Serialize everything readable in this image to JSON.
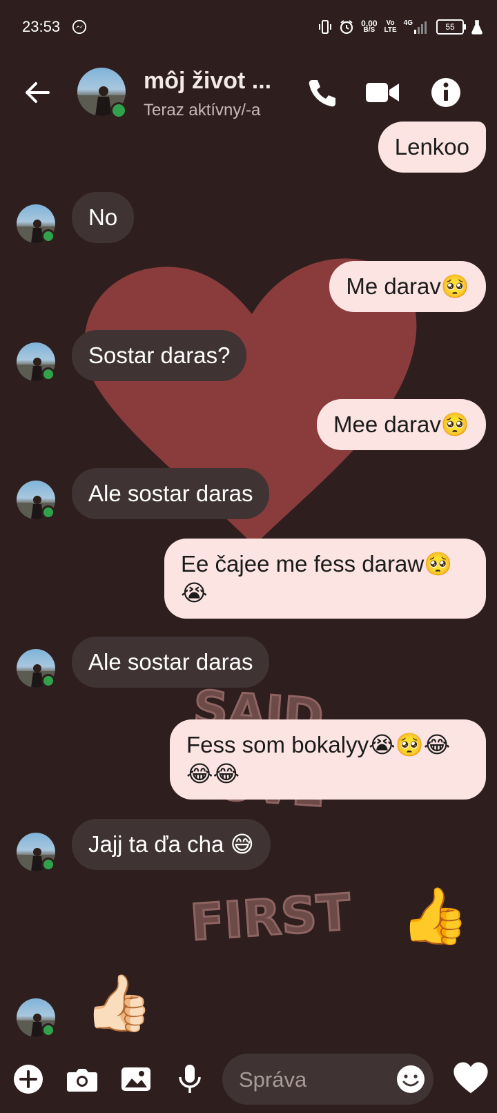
{
  "status_bar": {
    "time": "23:53",
    "net_speed": "0,00",
    "net_unit": "B/S",
    "volte": "Vo",
    "lte": "LTE",
    "network": "4G",
    "battery": "55"
  },
  "header": {
    "contact_name": "môj život ...",
    "presence": "Teraz aktívny/-a"
  },
  "messages": [
    {
      "direction": "out",
      "text": "Lenkoo"
    },
    {
      "direction": "in",
      "text": "No"
    },
    {
      "direction": "out",
      "text": "Me darav🥺"
    },
    {
      "direction": "in",
      "text": "Sostar daras?"
    },
    {
      "direction": "out",
      "text": "Mee darav🥺"
    },
    {
      "direction": "in",
      "text": "Ale sostar daras"
    },
    {
      "direction": "out",
      "text": "Ee čajee me fess daraw🥺😭"
    },
    {
      "direction": "in",
      "text": "Ale sostar daras"
    },
    {
      "direction": "out",
      "text": "Fess som bokalyy😭🥺😂😂😂"
    },
    {
      "direction": "in",
      "text": "Jajj ta ďa cha 😅"
    },
    {
      "direction": "out",
      "text": "👍"
    },
    {
      "direction": "in",
      "text": "👍🏻"
    }
  ],
  "background_art": {
    "words": [
      "SAID",
      "LOVE",
      "FIRST"
    ]
  },
  "composer": {
    "placeholder": "Správa"
  },
  "icons": [
    "back-arrow-icon",
    "phone-icon",
    "video-camera-icon",
    "info-icon",
    "plus-icon",
    "camera-icon",
    "image-icon",
    "microphone-icon",
    "smiley-icon",
    "heart-icon",
    "messenger-icon"
  ],
  "colors": {
    "background": "#2e1e1e",
    "heart": "#8a3c3c",
    "incoming_bubble": "#3f3433",
    "outgoing_bubble": "#fbe4e2",
    "online": "#31a24c"
  }
}
